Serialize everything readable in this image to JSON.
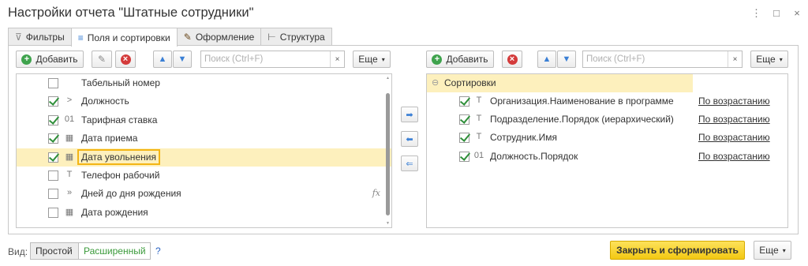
{
  "window": {
    "title": "Настройки отчета \"Штатные сотрудники\"",
    "more_icon": "⋮",
    "max_icon": "□",
    "close_icon": "×"
  },
  "tabs": [
    {
      "label": "Фильтры",
      "icon": "funnel-icon",
      "glyph": "⊽",
      "active": false
    },
    {
      "label": "Поля и сортировки",
      "icon": "fields-sort-icon",
      "glyph": "≡",
      "active": true
    },
    {
      "label": "Оформление",
      "icon": "brush-icon",
      "glyph": "✎",
      "active": false
    },
    {
      "label": "Структура",
      "icon": "structure-icon",
      "glyph": "⊢",
      "active": false
    }
  ],
  "left_toolbar": {
    "add_label": "Добавить",
    "search_placeholder": "Поиск (Ctrl+F)",
    "clear_glyph": "×",
    "more_label": "Еще",
    "more_glyph": "▾"
  },
  "fields": [
    {
      "label": "Табельный номер",
      "checked": false,
      "type_glyph": "",
      "selected": false,
      "fx": ""
    },
    {
      "label": "Должность",
      "checked": true,
      "type_glyph": ">",
      "selected": false,
      "fx": ""
    },
    {
      "label": "Тарифная ставка",
      "checked": true,
      "type_glyph": "01",
      "selected": false,
      "fx": ""
    },
    {
      "label": "Дата приема",
      "checked": true,
      "type_glyph": "▦",
      "selected": false,
      "fx": ""
    },
    {
      "label": "Дата увольнения",
      "checked": true,
      "type_glyph": "▦",
      "selected": true,
      "fx": ""
    },
    {
      "label": "Телефон рабочий",
      "checked": false,
      "type_glyph": "T",
      "selected": false,
      "fx": ""
    },
    {
      "label": "Дней до дня рождения",
      "checked": false,
      "type_glyph": "»",
      "selected": false,
      "fx": "fx"
    },
    {
      "label": "Дата рождения",
      "checked": false,
      "type_glyph": "▦",
      "selected": false,
      "fx": ""
    }
  ],
  "middle_buttons": {
    "move_right_glyph": "➡",
    "move_left_glyph": "⬅",
    "move_all_left_glyph": "⇐"
  },
  "right_toolbar": {
    "add_label": "Добавить",
    "search_placeholder": "Поиск (Ctrl+F)",
    "clear_glyph": "×",
    "more_label": "Еще",
    "more_glyph": "▾"
  },
  "sorting": {
    "group_label": "Сортировки",
    "group_glyph": "⊖",
    "items": [
      {
        "label": "Организация.Наименование в программе",
        "type_glyph": "T",
        "checked": true,
        "direction": "По возрастанию"
      },
      {
        "label": "Подразделение.Порядок (иерархический)",
        "type_glyph": "T",
        "checked": true,
        "direction": "По возрастанию"
      },
      {
        "label": "Сотрудник.Имя",
        "type_glyph": "T",
        "checked": true,
        "direction": "По возрастанию"
      },
      {
        "label": "Должность.Порядок",
        "type_glyph": "01",
        "checked": true,
        "direction": "По возрастанию"
      }
    ]
  },
  "footer": {
    "view_label": "Вид:",
    "mode_simple": "Простой",
    "mode_extended": "Расширенный",
    "help": "?",
    "primary_button": "Закрыть и сформировать",
    "more_label": "Еще",
    "more_glyph": "▾"
  },
  "colors": {
    "accent_yellow": "#f3c813",
    "selection_bg": "#fdf0bd",
    "check_green": "#2f8f3a",
    "add_green": "#3fa34d",
    "delete_red": "#d43b3b",
    "arrow_blue": "#3a7fd5",
    "extended_mode_text": "#3a9a3a"
  }
}
